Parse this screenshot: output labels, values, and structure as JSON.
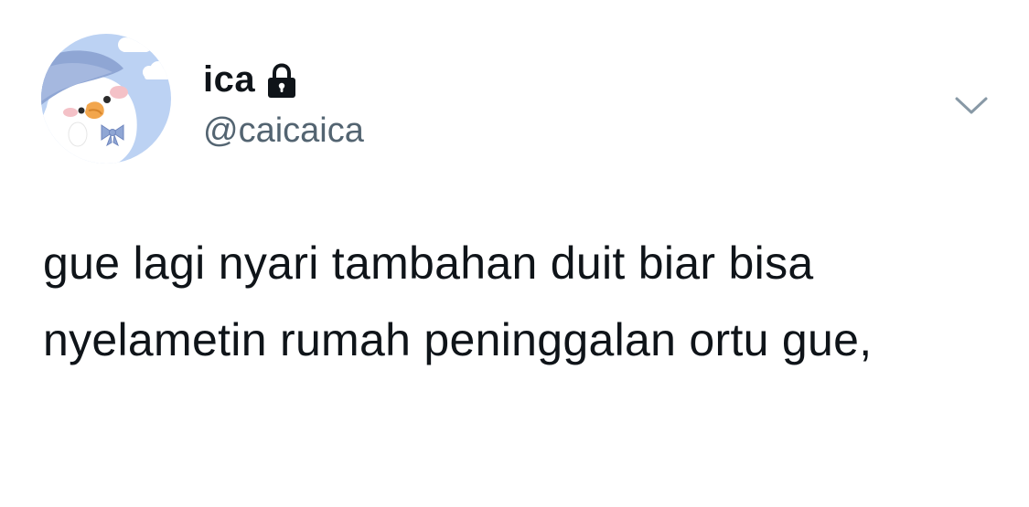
{
  "tweet": {
    "author": {
      "display_name": "ica",
      "handle": "@caicaica",
      "protected_icon": "lock-icon",
      "avatar_icon": "duck-avatar"
    },
    "more_icon": "chevron-down-icon",
    "text": "gue lagi nyari tambahan duit biar bisa nyelametin rumah peninggalan ortu gue,"
  },
  "colors": {
    "text": "#0f1419",
    "secondary": "#536471",
    "avatar_sky": "#b9cff2",
    "chevron": "#8899a6"
  }
}
